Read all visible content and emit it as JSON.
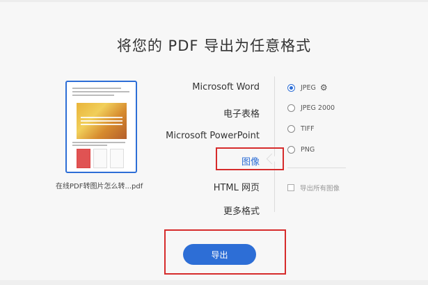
{
  "page": {
    "title": "将您的 PDF 导出为任意格式"
  },
  "file": {
    "name": "在线PDF转图片怎么转...pdf"
  },
  "formats": [
    {
      "label": "Microsoft Word",
      "selected": false
    },
    {
      "label": "电子表格",
      "selected": false
    },
    {
      "label": "Microsoft PowerPoint",
      "selected": false
    },
    {
      "label": "图像",
      "selected": true
    },
    {
      "label": "HTML 网页",
      "selected": false
    },
    {
      "label": "更多格式",
      "selected": false
    }
  ],
  "image_options": [
    {
      "label": "JPEG",
      "selected": true,
      "icon": "gear-icon"
    },
    {
      "label": "JPEG 2000",
      "selected": false
    },
    {
      "label": "TIFF",
      "selected": false
    },
    {
      "label": "PNG",
      "selected": false
    }
  ],
  "export_all_images": {
    "label": "导出所有图像",
    "checked": false,
    "enabled": false
  },
  "export_button": {
    "label": "导出"
  },
  "colors": {
    "accent": "#2d6ed6",
    "highlight": "#d62b2b"
  }
}
